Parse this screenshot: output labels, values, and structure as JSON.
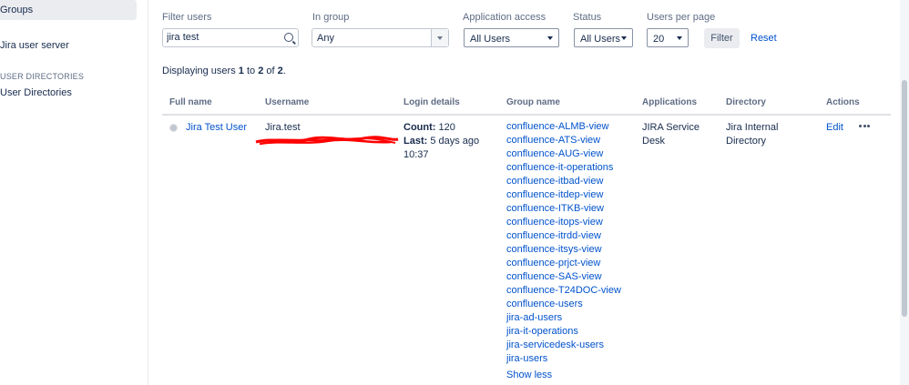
{
  "sidebar": {
    "selected_item": "Groups",
    "items": [
      "Jira user server"
    ],
    "section_heading": "USER DIRECTORIES",
    "section_items": [
      "User Directories"
    ]
  },
  "filters": {
    "filter_users": {
      "label": "Filter users",
      "value": "jira test"
    },
    "in_group": {
      "label": "In group",
      "value": "Any"
    },
    "application_access": {
      "label": "Application access",
      "value": "All Users"
    },
    "status": {
      "label": "Status",
      "value": "All Users"
    },
    "users_per_page": {
      "label": "Users per page",
      "value": "20"
    },
    "filter_button": "Filter",
    "reset_link": "Reset"
  },
  "summary": {
    "prefix": "Displaying users",
    "from": "1",
    "to_word": "to",
    "to": "2",
    "of_word": "of",
    "total": "2",
    "end": "."
  },
  "table": {
    "headers": [
      "Full name",
      "Username",
      "Login details",
      "Group name",
      "Applications",
      "Directory",
      "Actions"
    ],
    "row": {
      "full_name": "Jira Test User",
      "username": "Jira.test",
      "count_label": "Count:",
      "count_value": "120",
      "last_label": "Last:",
      "last_value": "5 days ago",
      "last_time": "10:37",
      "groups": [
        "confluence-ALMB-view",
        "confluence-ATS-view",
        "confluence-AUG-view",
        "confluence-it-operations",
        "confluence-itbad-view",
        "confluence-itdep-view",
        "confluence-ITKB-view",
        "confluence-itops-view",
        "confluence-itrdd-view",
        "confluence-itsys-view",
        "confluence-prjct-view",
        "confluence-SAS-view",
        "confluence-T24DOC-view",
        "confluence-users",
        "jira-ad-users",
        "jira-it-operations",
        "jira-servicedesk-users",
        "jira-users"
      ],
      "show_less": "Show less",
      "applications": [
        "JIRA Service",
        "Desk"
      ],
      "directory": [
        "Jira Internal",
        "Directory"
      ],
      "edit": "Edit"
    }
  },
  "icons": {
    "search": "search-icon",
    "more": "more-actions-icon",
    "avatar": "user-avatar-icon"
  },
  "colors": {
    "link": "#0052cc",
    "text": "#172b4d",
    "muted": "#5e6c84",
    "redaction": "#ff0000"
  }
}
